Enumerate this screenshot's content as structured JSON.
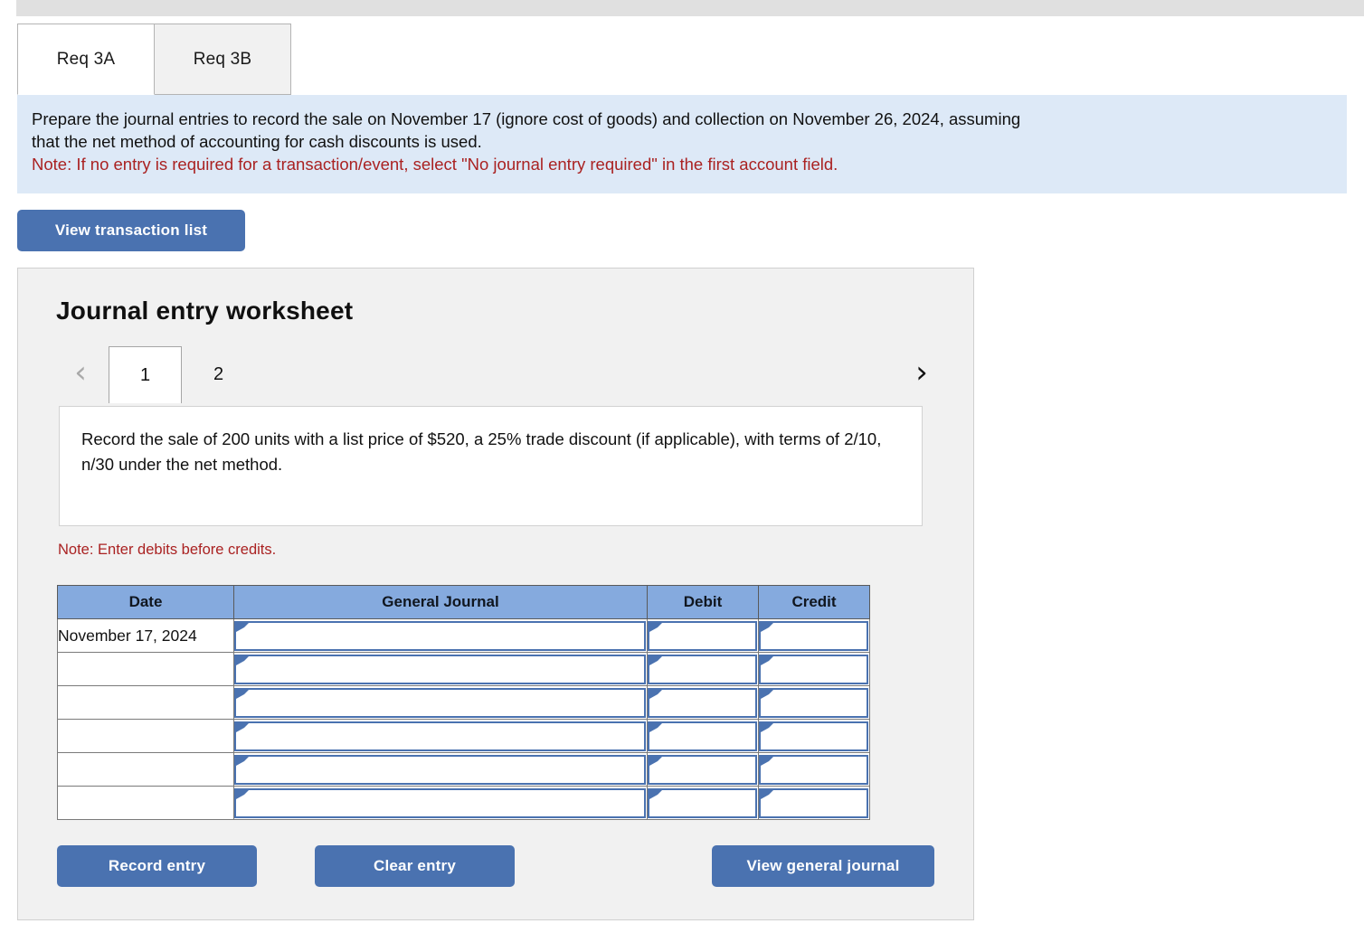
{
  "req_tabs": [
    {
      "label": "Req 3A",
      "active": true
    },
    {
      "label": "Req 3B",
      "active": false
    }
  ],
  "instructions": {
    "line1": "Prepare the journal entries to record the sale on November 17 (ignore cost of goods) and collection on November 26, 2024, assuming",
    "line2": "that the net method of accounting for cash discounts is used.",
    "note": "Note: If no entry is required for a transaction/event, select \"No journal entry required\" in the first account field.",
    "background": "#dde9f7",
    "note_color": "#aa2222"
  },
  "toolbar": {
    "view_transaction_list_label": "View transaction list",
    "button_color": "#4a72b0"
  },
  "worksheet": {
    "title": "Journal entry worksheet",
    "pager": {
      "prev_icon": "chevron-left-icon",
      "next_icon": "chevron-right-icon",
      "prev_enabled": false,
      "next_enabled": true,
      "pages": [
        {
          "label": "1",
          "active": true
        },
        {
          "label": "2",
          "active": false
        }
      ]
    },
    "description": "Record the sale of 200 units with a list price of $520, a 25% trade discount (if applicable), with terms of 2/10, n/30 under the net method.",
    "note_debits": "Note: Enter debits before credits.",
    "table": {
      "header_color": "#85aade",
      "columns": [
        "Date",
        "General Journal",
        "Debit",
        "Credit"
      ],
      "rows": [
        {
          "date": "November 17, 2024",
          "general_journal": "",
          "debit": "",
          "credit": ""
        },
        {
          "date": "",
          "general_journal": "",
          "debit": "",
          "credit": ""
        },
        {
          "date": "",
          "general_journal": "",
          "debit": "",
          "credit": ""
        },
        {
          "date": "",
          "general_journal": "",
          "debit": "",
          "credit": ""
        },
        {
          "date": "",
          "general_journal": "",
          "debit": "",
          "credit": ""
        },
        {
          "date": "",
          "general_journal": "",
          "debit": "",
          "credit": ""
        }
      ]
    },
    "actions": {
      "record_entry_label": "Record entry",
      "clear_entry_label": "Clear entry",
      "view_general_journal_label": "View general journal"
    }
  }
}
